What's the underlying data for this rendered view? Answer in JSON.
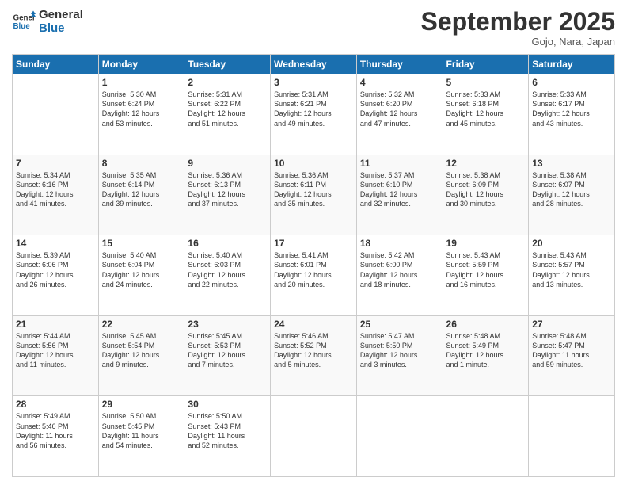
{
  "logo": {
    "line1": "General",
    "line2": "Blue"
  },
  "title": "September 2025",
  "subtitle": "Gojo, Nara, Japan",
  "header_days": [
    "Sunday",
    "Monday",
    "Tuesday",
    "Wednesday",
    "Thursday",
    "Friday",
    "Saturday"
  ],
  "weeks": [
    [
      {
        "day": "",
        "text": ""
      },
      {
        "day": "1",
        "text": "Sunrise: 5:30 AM\nSunset: 6:24 PM\nDaylight: 12 hours\nand 53 minutes."
      },
      {
        "day": "2",
        "text": "Sunrise: 5:31 AM\nSunset: 6:22 PM\nDaylight: 12 hours\nand 51 minutes."
      },
      {
        "day": "3",
        "text": "Sunrise: 5:31 AM\nSunset: 6:21 PM\nDaylight: 12 hours\nand 49 minutes."
      },
      {
        "day": "4",
        "text": "Sunrise: 5:32 AM\nSunset: 6:20 PM\nDaylight: 12 hours\nand 47 minutes."
      },
      {
        "day": "5",
        "text": "Sunrise: 5:33 AM\nSunset: 6:18 PM\nDaylight: 12 hours\nand 45 minutes."
      },
      {
        "day": "6",
        "text": "Sunrise: 5:33 AM\nSunset: 6:17 PM\nDaylight: 12 hours\nand 43 minutes."
      }
    ],
    [
      {
        "day": "7",
        "text": "Sunrise: 5:34 AM\nSunset: 6:16 PM\nDaylight: 12 hours\nand 41 minutes."
      },
      {
        "day": "8",
        "text": "Sunrise: 5:35 AM\nSunset: 6:14 PM\nDaylight: 12 hours\nand 39 minutes."
      },
      {
        "day": "9",
        "text": "Sunrise: 5:36 AM\nSunset: 6:13 PM\nDaylight: 12 hours\nand 37 minutes."
      },
      {
        "day": "10",
        "text": "Sunrise: 5:36 AM\nSunset: 6:11 PM\nDaylight: 12 hours\nand 35 minutes."
      },
      {
        "day": "11",
        "text": "Sunrise: 5:37 AM\nSunset: 6:10 PM\nDaylight: 12 hours\nand 32 minutes."
      },
      {
        "day": "12",
        "text": "Sunrise: 5:38 AM\nSunset: 6:09 PM\nDaylight: 12 hours\nand 30 minutes."
      },
      {
        "day": "13",
        "text": "Sunrise: 5:38 AM\nSunset: 6:07 PM\nDaylight: 12 hours\nand 28 minutes."
      }
    ],
    [
      {
        "day": "14",
        "text": "Sunrise: 5:39 AM\nSunset: 6:06 PM\nDaylight: 12 hours\nand 26 minutes."
      },
      {
        "day": "15",
        "text": "Sunrise: 5:40 AM\nSunset: 6:04 PM\nDaylight: 12 hours\nand 24 minutes."
      },
      {
        "day": "16",
        "text": "Sunrise: 5:40 AM\nSunset: 6:03 PM\nDaylight: 12 hours\nand 22 minutes."
      },
      {
        "day": "17",
        "text": "Sunrise: 5:41 AM\nSunset: 6:01 PM\nDaylight: 12 hours\nand 20 minutes."
      },
      {
        "day": "18",
        "text": "Sunrise: 5:42 AM\nSunset: 6:00 PM\nDaylight: 12 hours\nand 18 minutes."
      },
      {
        "day": "19",
        "text": "Sunrise: 5:43 AM\nSunset: 5:59 PM\nDaylight: 12 hours\nand 16 minutes."
      },
      {
        "day": "20",
        "text": "Sunrise: 5:43 AM\nSunset: 5:57 PM\nDaylight: 12 hours\nand 13 minutes."
      }
    ],
    [
      {
        "day": "21",
        "text": "Sunrise: 5:44 AM\nSunset: 5:56 PM\nDaylight: 12 hours\nand 11 minutes."
      },
      {
        "day": "22",
        "text": "Sunrise: 5:45 AM\nSunset: 5:54 PM\nDaylight: 12 hours\nand 9 minutes."
      },
      {
        "day": "23",
        "text": "Sunrise: 5:45 AM\nSunset: 5:53 PM\nDaylight: 12 hours\nand 7 minutes."
      },
      {
        "day": "24",
        "text": "Sunrise: 5:46 AM\nSunset: 5:52 PM\nDaylight: 12 hours\nand 5 minutes."
      },
      {
        "day": "25",
        "text": "Sunrise: 5:47 AM\nSunset: 5:50 PM\nDaylight: 12 hours\nand 3 minutes."
      },
      {
        "day": "26",
        "text": "Sunrise: 5:48 AM\nSunset: 5:49 PM\nDaylight: 12 hours\nand 1 minute."
      },
      {
        "day": "27",
        "text": "Sunrise: 5:48 AM\nSunset: 5:47 PM\nDaylight: 11 hours\nand 59 minutes."
      }
    ],
    [
      {
        "day": "28",
        "text": "Sunrise: 5:49 AM\nSunset: 5:46 PM\nDaylight: 11 hours\nand 56 minutes."
      },
      {
        "day": "29",
        "text": "Sunrise: 5:50 AM\nSunset: 5:45 PM\nDaylight: 11 hours\nand 54 minutes."
      },
      {
        "day": "30",
        "text": "Sunrise: 5:50 AM\nSunset: 5:43 PM\nDaylight: 11 hours\nand 52 minutes."
      },
      {
        "day": "",
        "text": ""
      },
      {
        "day": "",
        "text": ""
      },
      {
        "day": "",
        "text": ""
      },
      {
        "day": "",
        "text": ""
      }
    ]
  ]
}
